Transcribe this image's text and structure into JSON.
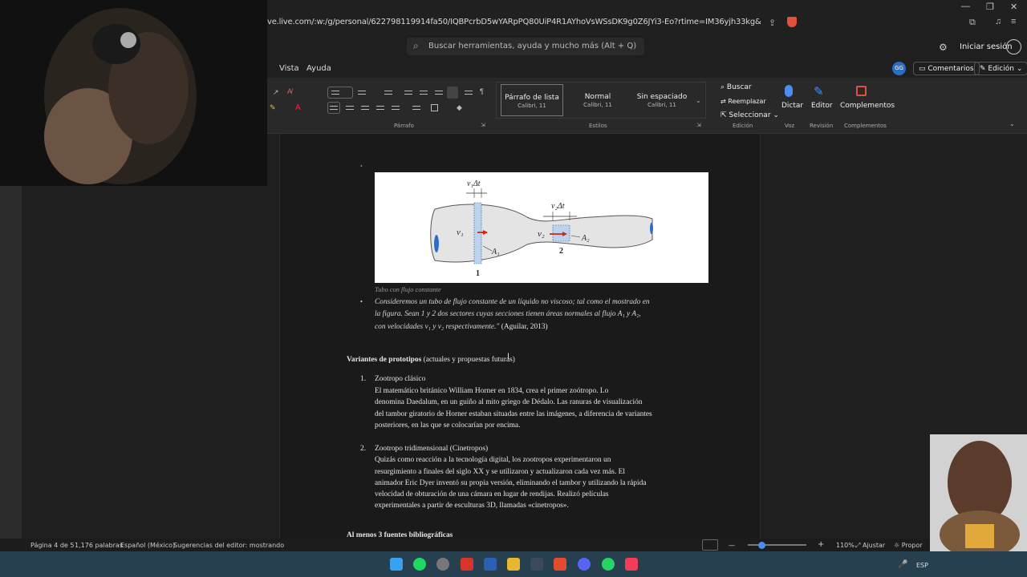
{
  "browser": {
    "url": "ve.live.com/:w:/g/personal/622798119914fa50/IQBPcrbD5wYARpPQ80UiP4R1AYhoVsWSsDK9g0Z6JYi3-Eo?rtime=IM36yjh33kg&redeem=aHR0cHM..."
  },
  "header": {
    "search_placeholder": "Buscar herramientas, ayuda y mucho más (Alt + Q)",
    "signin_label": "Iniciar sesión",
    "user_initials": "GG"
  },
  "menu": {
    "items": [
      "Vista",
      "Ayuda"
    ],
    "comments_label": "Comentarios",
    "edit_mode_label": "Edición"
  },
  "ribbon": {
    "paragraph_group": "Párrafo",
    "styles_group": "Estilos",
    "styles": [
      {
        "name": "Párrafo de lista",
        "font": "Calibri, 11"
      },
      {
        "name": "Normal",
        "font": "Calibri, 11"
      },
      {
        "name": "Sin espaciado",
        "font": "Calibri, 11"
      }
    ],
    "buscar": "Buscar",
    "reemplazar": "Reemplazar",
    "seleccionar": "Seleccionar",
    "edicion_group": "Edición",
    "dictar": "Dictar",
    "voz_group": "Voz",
    "editor": "Editor",
    "revision_group": "Revisión",
    "complementos": "Complementos",
    "complementos_group": "Complementos"
  },
  "figure": {
    "labels": {
      "v1dt": "v₁Δt",
      "v2dt": "v₂Δt",
      "v1": "v₁",
      "v2": "v₂",
      "a1": "A₁",
      "a2": "A₂",
      "sec1": "1",
      "sec2": "2"
    }
  },
  "document": {
    "caption": "Tubo con flujo constante",
    "bullet_lines": [
      "Consideremos un tubo de flujo constante de un líquido no viscoso; tal como el mostrado en",
      "la figura. Sean 1 y 2 dos sectores cuyas secciones tienen áreas normales al flujo A₁ y A₂,",
      "con velocidades v₁ y v₂ respectivamente.\""
    ],
    "citation": " (Aguilar, 2013)",
    "section_title_bold": "Variantes de prototipos",
    "section_title_rest": " (actuales y propuestas futuras)",
    "items": [
      {
        "number": "1.",
        "title": "Zootropo clásico",
        "lines": [
          "El matemático británico William Horner en 1834, crea el primer zoótropo. Lo",
          "denomina Daedalum, en un guiño al mito griego de Dédalo. Las ranuras de visualización",
          "del tambor giratorio de Horner estaban situadas entre las imágenes, a diferencia de variantes",
          "posteriores, en las que se colocarían por encima."
        ]
      },
      {
        "number": "2.",
        "title": "Zootropo tridimensional (Cinetropos)",
        "lines": [
          "Quizás como reacción a la tecnología digital, los zootropos experimentaron un",
          "resurgimiento a finales del siglo XX y se utilizaron y actualizaron cada vez más. El",
          "animador Eric Dyer inventó su propia versión, eliminando el tambor y utilizando la rápida",
          "velocidad de obturación de una cámara en lugar de rendijas. Realizó películas",
          "experimentales a partir de esculturas 3D, llamadas «cinetropos»."
        ]
      }
    ],
    "next_heading": "Al menos 3 fuentes bibliográficas"
  },
  "status": {
    "page": "Página 4 de 5",
    "words": "1,176 palabras",
    "language": "Español (México)",
    "editor_suggestions": "Sugerencias del editor: mostrando",
    "zoom": "110%",
    "fit": "Ajustar",
    "feedback": "Propor"
  },
  "taskbar": {
    "lang": "ESP"
  }
}
